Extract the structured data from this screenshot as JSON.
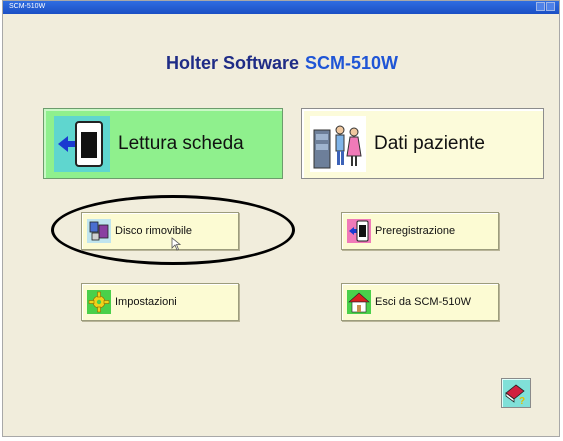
{
  "window": {
    "title": "SCM-510W"
  },
  "app": {
    "title": "Holter Software",
    "product": "SCM-510W"
  },
  "buttons": {
    "lettura": {
      "label": "Lettura scheda",
      "icon": "card-reader-icon"
    },
    "dati": {
      "label": "Dati paziente",
      "icon": "patients-icon"
    },
    "disco": {
      "label": "Disco rimovibile",
      "icon": "removable-disk-icon"
    },
    "prereg": {
      "label": "Preregistrazione",
      "icon": "preregistration-icon"
    },
    "impost": {
      "label": "Impostazioni",
      "icon": "settings-gear-icon"
    },
    "esci": {
      "label": "Esci da SCM-510W",
      "icon": "home-exit-icon"
    },
    "help": {
      "icon": "help-book-icon"
    }
  },
  "colors": {
    "title_primary": "#1f2c86",
    "title_product": "#1f55d6",
    "window_bg": "#f1eddc",
    "lettura_bg": "#8ff08d",
    "button_bg": "#fcfbd3"
  }
}
